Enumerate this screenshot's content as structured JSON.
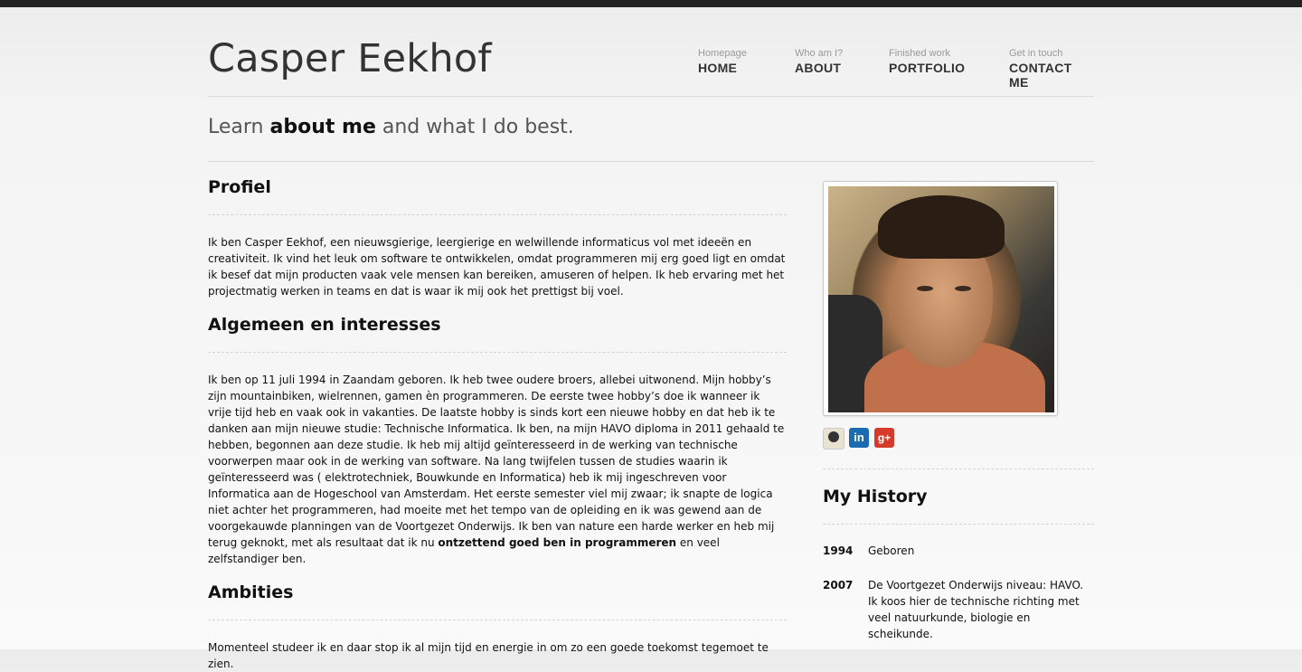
{
  "site": {
    "title": "Casper Eekhof"
  },
  "nav": [
    {
      "sub": "Homepage",
      "label": "HOME"
    },
    {
      "sub": "Who am I?",
      "label": "ABOUT"
    },
    {
      "sub": "Finished work",
      "label": "PORTFOLIO"
    },
    {
      "sub": "Get in touch",
      "label": "CONTACT ME"
    }
  ],
  "tagline": {
    "pre": "Learn ",
    "bold": "about me",
    "post": " and what I do best."
  },
  "sections": [
    {
      "heading": "Profiel",
      "text": "Ik ben Casper Eekhof, een nieuwsgierige, leergierige en welwillende informaticus vol met ideeën en creativiteit. Ik vind het leuk om software te ontwikkelen, omdat programmeren mij erg goed ligt en omdat ik besef dat mijn producten vaak vele mensen kan bereiken, amuseren of helpen. Ik heb ervaring met het projectmatig werken in teams en dat is waar ik mij ook het prettigst bij voel."
    },
    {
      "heading": "Algemeen en interesses",
      "text": "Ik ben op 11 juli 1994 in Zaandam geboren. Ik heb twee oudere broers, allebei uitwonend. Mijn hobby’s zijn mountainbiken, wielrennen, gamen èn programmeren. De eerste twee hobby’s doe ik wanneer ik vrije tijd heb en vaak ook in vakanties. De laatste hobby is sinds kort een nieuwe hobby en dat heb ik te danken aan mijn nieuwe studie: Technische Informatica. Ik ben, na mijn HAVO diploma in 2011 gehaald te hebben, begonnen aan deze studie. Ik heb mij altijd geïnteresseerd in de werking van technische voorwerpen maar ook in de werking van software. Na lang twijfelen tussen de studies waarin ik geïnteresseerd was ( elektrotechniek, Bouwkunde en Informatica) heb ik mij ingeschreven voor Informatica aan de Hogeschool van Amsterdam. Het eerste semester viel mij zwaar; ik snapte de logica niet achter het programmeren, had moeite met het tempo van de opleiding en ik was gewend aan de voorgekauwde planningen van de Voortgezet Onderwijs. Ik ben van nature een harde werker en heb mij terug geknokt, met als resultaat dat ik nu ",
      "bold": "ontzettend goed ben in programmeren",
      "tail": " en veel zelfstandiger ben."
    },
    {
      "heading": "Ambities",
      "text": "Momenteel studeer ik en daar stop ik al mijn tijd en energie in om zo een goede toekomst tegemoet te zien."
    }
  ],
  "sidebar": {
    "social": [
      {
        "icon": "github-icon",
        "label": ""
      },
      {
        "icon": "linkedin-icon",
        "label": "in"
      },
      {
        "icon": "googleplus-icon",
        "label": "g+"
      }
    ],
    "history_title": "My History",
    "history": [
      {
        "year": "1994",
        "text": "Geboren"
      },
      {
        "year": "2007",
        "text": "De Voortgezet Onderwijs niveau: HAVO. Ik koos hier de technische richting met veel natuurkunde, biologie en scheikunde."
      }
    ]
  }
}
